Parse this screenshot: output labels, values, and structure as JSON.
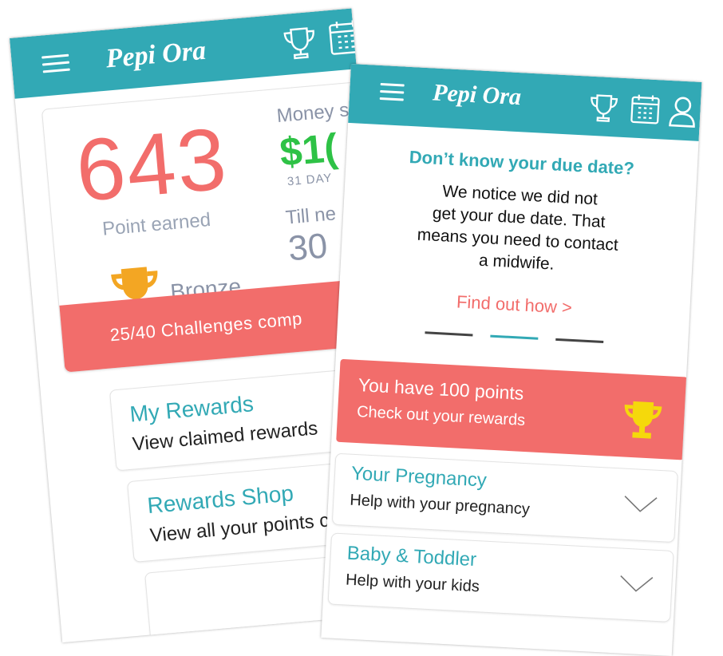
{
  "colors": {
    "accent": "#32a9b5",
    "coral": "#f26d6b",
    "money_green": "#2ec246",
    "trophy_gold_back": "#f3a623",
    "trophy_gold_front": "#f5d90b",
    "muted_text": "#8a93a7"
  },
  "icons": {
    "menu": "hamburger-icon",
    "achievements": "trophy-icon",
    "calendar": "calendar-icon",
    "profile": "user-icon",
    "expand": "chevron-down-icon"
  },
  "app": {
    "brand": "Pepi Ora"
  },
  "back_screen": {
    "points_value": "643",
    "points_label": "Point earned",
    "tier_label": "Bronze",
    "money_label": "Money s",
    "money_value": "$1(",
    "days_label": "31 DAY",
    "till_label": "Till ne",
    "till_value": "30",
    "challenges_text": "25/40 Challenges comp",
    "menu": [
      {
        "title": "My Rewards",
        "subtitle": "View claimed rewards"
      },
      {
        "title": "Rewards Shop",
        "subtitle": "View all your points c"
      }
    ]
  },
  "front_screen": {
    "due_title": "Don’t know your due date?",
    "due_body_lines": [
      "We notice we did not",
      "get your due date. That",
      "means you need to contact",
      "a midwife."
    ],
    "find_link": "Find out how >",
    "carousel_pages": 3,
    "carousel_active": 2,
    "rewards_banner": {
      "title": "You have 100 points",
      "subtitle": "Check out your rewards"
    },
    "sections": [
      {
        "title": "Your Pregnancy",
        "subtitle": "Help with your pregnancy"
      },
      {
        "title": "Baby & Toddler",
        "subtitle": "Help with your kids"
      }
    ]
  }
}
